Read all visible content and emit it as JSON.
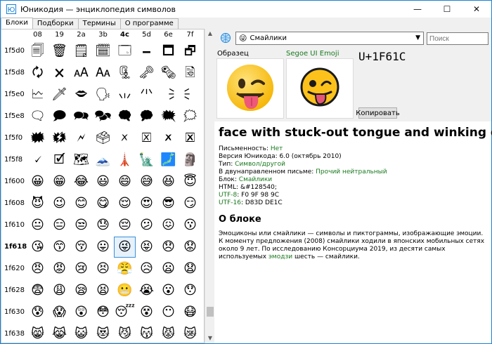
{
  "window": {
    "title": "Юникодия — энциклопедия символов",
    "minimize": "—",
    "maximize": "☐",
    "close": "✕"
  },
  "tabs": [
    "Блоки",
    "Подборки",
    "Термины",
    "О программе"
  ],
  "grid": {
    "columns": [
      "08",
      "19",
      "2a",
      "3b",
      "4c",
      "5d",
      "6e",
      "7f"
    ],
    "selected_row": "1f618",
    "selected_col": "4c",
    "rows": [
      {
        "label": "1f5d0",
        "cells": [
          "🗐",
          "🗑",
          "🗒",
          "🗓",
          "🗔",
          "🗕",
          "🗖",
          "🗗"
        ]
      },
      {
        "label": "1f5d8",
        "cells": [
          "🗘",
          "🗙",
          "🗚",
          "🗛",
          "🗜",
          "🗝",
          "🗞",
          "🗟"
        ]
      },
      {
        "label": "1f5e0",
        "cells": [
          "🗠",
          "🗡",
          "🗢",
          "🗣",
          "🗤",
          "🗥",
          "🗦",
          "🗧"
        ]
      },
      {
        "label": "1f5e8",
        "cells": [
          "🗨",
          "🗩",
          "🗪",
          "🗫",
          "🗬",
          "🗭",
          "🗮",
          "🗯"
        ]
      },
      {
        "label": "1f5f0",
        "cells": [
          "🗰",
          "🗱",
          "🗲",
          "🗳",
          "🗴",
          "🗵",
          "🗶",
          "🗷"
        ]
      },
      {
        "label": "1f5f8",
        "cells": [
          "🗸",
          "🗹",
          "🗺",
          "🗻",
          "🗼",
          "🗽",
          "🗾",
          "🗿"
        ]
      },
      {
        "label": "1f600",
        "cells": [
          "😀",
          "😁",
          "😂",
          "😃",
          "😄",
          "😅",
          "😆",
          "😇"
        ]
      },
      {
        "label": "1f608",
        "cells": [
          "😈",
          "😉",
          "😊",
          "😋",
          "😌",
          "😍",
          "😎",
          "😏"
        ]
      },
      {
        "label": "1f610",
        "cells": [
          "😐",
          "😑",
          "😒",
          "😓",
          "😔",
          "😕",
          "😖",
          "😗"
        ]
      },
      {
        "label": "1f618",
        "cells": [
          "😘",
          "😙",
          "😚",
          "😛",
          "😜",
          "😝",
          "😞",
          "😟"
        ]
      },
      {
        "label": "1f620",
        "cells": [
          "😠",
          "😡",
          "😢",
          "😣",
          "😤",
          "😥",
          "😦",
          "😧"
        ]
      },
      {
        "label": "1f628",
        "cells": [
          "😨",
          "😩",
          "😪",
          "😫",
          "😬",
          "😭",
          "😮",
          "😯"
        ]
      },
      {
        "label": "1f630",
        "cells": [
          "😰",
          "😱",
          "😲",
          "😳",
          "😴",
          "😵",
          "😶",
          "😷"
        ]
      },
      {
        "label": "1f638",
        "cells": [
          "😸",
          "😹",
          "😺",
          "😻",
          "😼",
          "😽",
          "😾",
          "😿"
        ]
      }
    ]
  },
  "block_select": {
    "icon": "😜",
    "value": "Смайлики"
  },
  "search": {
    "placeholder": "Поиск"
  },
  "sample": {
    "label": "Образец",
    "font_label": "Segoe UI Emoji",
    "codepoint": "U+1F61C",
    "copy_label": "Копировать"
  },
  "info": {
    "name": "face with stuck-out tongue and winking eye",
    "writing_label": "Письменность:",
    "writing_value": "Нет",
    "version_label": "Версия Юникода:",
    "version_value": "6.0 (октябрь 2010)",
    "type_label": "Тип:",
    "type_value": "Символ/другой",
    "bidi_label": "В двунаправленном письме:",
    "bidi_value": "Прочий нейтральный",
    "block_label": "Блок:",
    "block_value": "Смайлики",
    "html_label": "HTML:",
    "html_value": "&#128540;",
    "utf8_label": "UTF-8",
    "utf8_value": ": F0 9F 98 9C",
    "utf16_label": "UTF-16",
    "utf16_value": ": D83D DE1C",
    "about_title": "О блоке",
    "about_1": "Эмоциконы или смайлики — символы и пиктограммы, изображающие эмоции. К моменту предложения (2008) смайлики ходили в японских мобильных сетях около 9 лет. По исследованию Консорциума 2019, из десяти самых используемых ",
    "about_link": "эмодзи",
    "about_2": " шесть — смайлики."
  },
  "colors": {
    "accent": "#1883d7",
    "link": "#19791e",
    "selection": "#3a8fd8"
  }
}
